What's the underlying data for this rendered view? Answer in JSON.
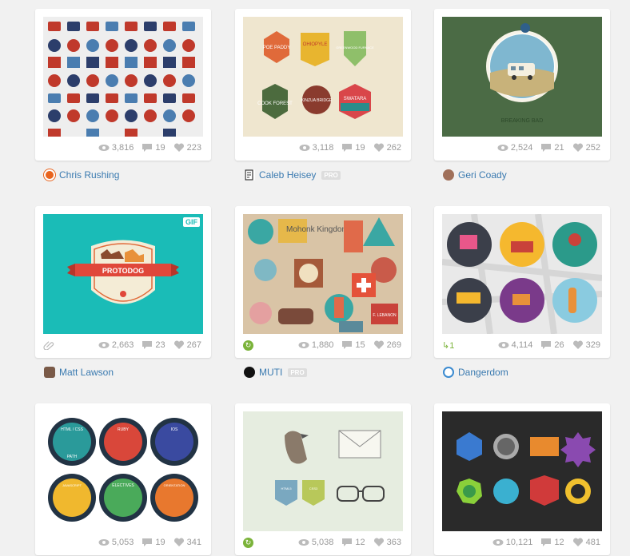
{
  "shots": [
    {
      "views": "3,816",
      "comments": "19",
      "likes": "223",
      "author": "Chris Rushing",
      "pro": "",
      "attach": false,
      "rebound": "",
      "gif": ""
    },
    {
      "views": "3,118",
      "comments": "19",
      "likes": "262",
      "author": "Caleb Heisey",
      "pro": "PRO",
      "attach": false,
      "rebound": "",
      "gif": ""
    },
    {
      "views": "2,524",
      "comments": "21",
      "likes": "252",
      "author": "Geri Coady",
      "pro": "",
      "attach": false,
      "rebound": "",
      "gif": ""
    },
    {
      "views": "2,663",
      "comments": "23",
      "likes": "267",
      "author": "Matt Lawson",
      "pro": "",
      "attach": true,
      "rebound": "",
      "gif": "GIF"
    },
    {
      "views": "1,880",
      "comments": "15",
      "likes": "269",
      "author": "MUTI",
      "pro": "PRO",
      "attach": false,
      "rebound": "icon",
      "gif": ""
    },
    {
      "views": "4,114",
      "comments": "26",
      "likes": "329",
      "author": "Dangerdom",
      "pro": "",
      "attach": false,
      "rebound": "1",
      "gif": ""
    },
    {
      "views": "5,053",
      "comments": "19",
      "likes": "341",
      "author": "",
      "pro": "",
      "attach": false,
      "rebound": "",
      "gif": ""
    },
    {
      "views": "5,038",
      "comments": "12",
      "likes": "363",
      "author": "",
      "pro": "",
      "attach": false,
      "rebound": "icon",
      "gif": ""
    },
    {
      "views": "10,121",
      "comments": "12",
      "likes": "481",
      "author": "",
      "pro": "",
      "attach": false,
      "rebound": "",
      "gif": ""
    }
  ],
  "thumb_text": {
    "protodog": "PROTODOG",
    "breaking_bad": "BREAKING BAD",
    "poe_paddy": "POE PADDY",
    "ohiopyle": "OHIOPYLE",
    "cook_forest": "COOK FOREST",
    "kinzua": "KINZUA BRIDGE",
    "swatara": "SWATARA",
    "greenwood": "GREENWOOD FURNACE",
    "mohonk": "Mohonk Kingdom",
    "lebanon": "F. LEBANON",
    "html": "HTML / CSS",
    "ruby": "RUBY",
    "ios": "IOS",
    "javascript": "JAVASCRIPT",
    "electives": "ELECTIVES",
    "orientation": "ORIENTATION",
    "path": "PATH",
    "html_badge": "HTML5",
    "css_badge": "CSS3"
  },
  "colors": {
    "link": "#3a7ab0",
    "stat": "#999999",
    "rebound_green": "#7bb33a",
    "protodog_teal": "#1abcb7",
    "breaking_green": "#4b6b45"
  }
}
